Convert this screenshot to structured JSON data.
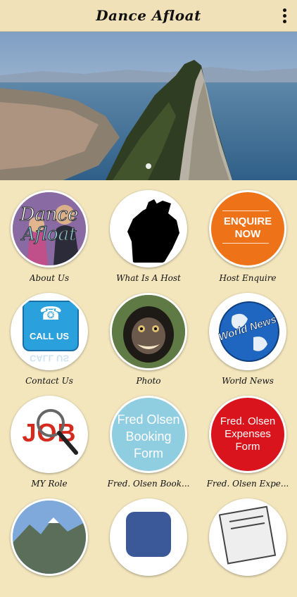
{
  "app": {
    "title": "Dance Afloat"
  },
  "hero": {
    "slide_index": 1,
    "slide_count": 1
  },
  "tiles": [
    {
      "label": "About Us",
      "logo_text_1": "Dance",
      "logo_text_2": "Afloat"
    },
    {
      "label": "What Is A Host"
    },
    {
      "label": "Host Enquire",
      "badge_line1": "ENQUIRE",
      "badge_line2": "NOW"
    },
    {
      "label": "Contact Us",
      "badge": "CALL US",
      "reflection": "CALL US"
    },
    {
      "label": "Photo"
    },
    {
      "label": "World News",
      "globe_text": "World News"
    },
    {
      "label": "MY Role",
      "job_text": "JOB"
    },
    {
      "label": "Fred. Olsen Book...",
      "line1": "Fred Olsen",
      "line2": "Booking",
      "line3": "Form"
    },
    {
      "label": "Fred. Olsen Expe...",
      "line1": "Fred. Olsen",
      "line2": "Expenses",
      "line3": "Form"
    }
  ],
  "colors": {
    "background": "#f3e6bd",
    "topbar": "#f1e1b8",
    "enquire_orange": "#ee7318",
    "booking_blue": "#8fcde0",
    "expenses_red": "#d9141c"
  }
}
